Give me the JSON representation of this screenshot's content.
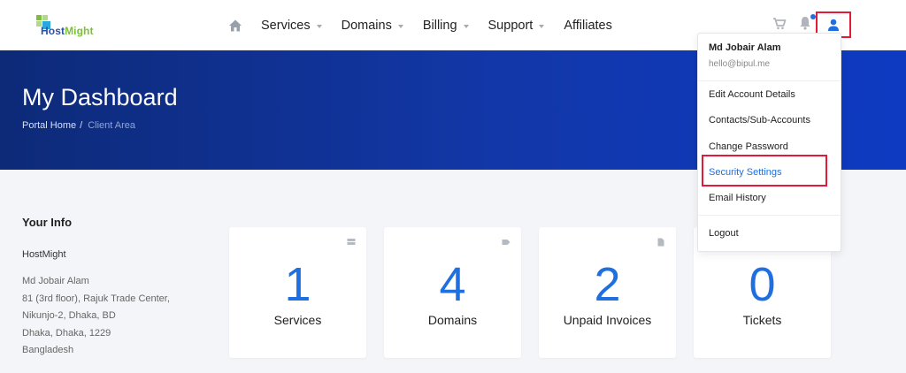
{
  "brand": {
    "logo_text_a": "Host",
    "logo_text_b": "Might",
    "logo_colors": [
      "#7cbf3a",
      "#2e4fa3",
      "#29a8df"
    ]
  },
  "nav": {
    "home_icon": "home-icon",
    "items": [
      {
        "label": "Services",
        "has_caret": true
      },
      {
        "label": "Domains",
        "has_caret": true
      },
      {
        "label": "Billing",
        "has_caret": true
      },
      {
        "label": "Support",
        "has_caret": true
      },
      {
        "label": "Affiliates",
        "has_caret": false
      }
    ]
  },
  "header_icons": [
    "cart-icon",
    "bell-icon",
    "user-icon"
  ],
  "hero": {
    "title": "My Dashboard",
    "breadcrumb": {
      "home": "Portal Home",
      "separator": "/",
      "current": "Client Area"
    }
  },
  "your_info": {
    "heading": "Your Info",
    "company": "HostMight",
    "address_lines": [
      "Md Jobair Alam",
      "81 (3rd floor), Rajuk Trade Center,",
      "Nikunjo-2, Dhaka, BD",
      "Dhaka, Dhaka, 1229",
      "Bangladesh"
    ]
  },
  "stats": [
    {
      "value": "1",
      "label": "Services",
      "icon": "server-icon"
    },
    {
      "value": "4",
      "label": "Domains",
      "icon": "tag-icon"
    },
    {
      "value": "2",
      "label": "Unpaid Invoices",
      "icon": "document-icon"
    },
    {
      "value": "0",
      "label": "Tickets",
      "icon": "ticket-icon"
    }
  ],
  "user_menu": {
    "name": "Md Jobair Alam",
    "email": "hello@bipul.me",
    "items": [
      {
        "label": "Edit Account Details"
      },
      {
        "label": "Contacts/Sub-Accounts"
      },
      {
        "label": "Change Password"
      },
      {
        "label": "Security Settings",
        "highlighted": true
      },
      {
        "label": "Email History"
      }
    ],
    "logout": "Logout"
  },
  "colors": {
    "accent": "#1f6fe0",
    "highlight_box": "#e21a3a",
    "hero_start": "#0d2a78",
    "hero_end": "#0e3ac2"
  }
}
